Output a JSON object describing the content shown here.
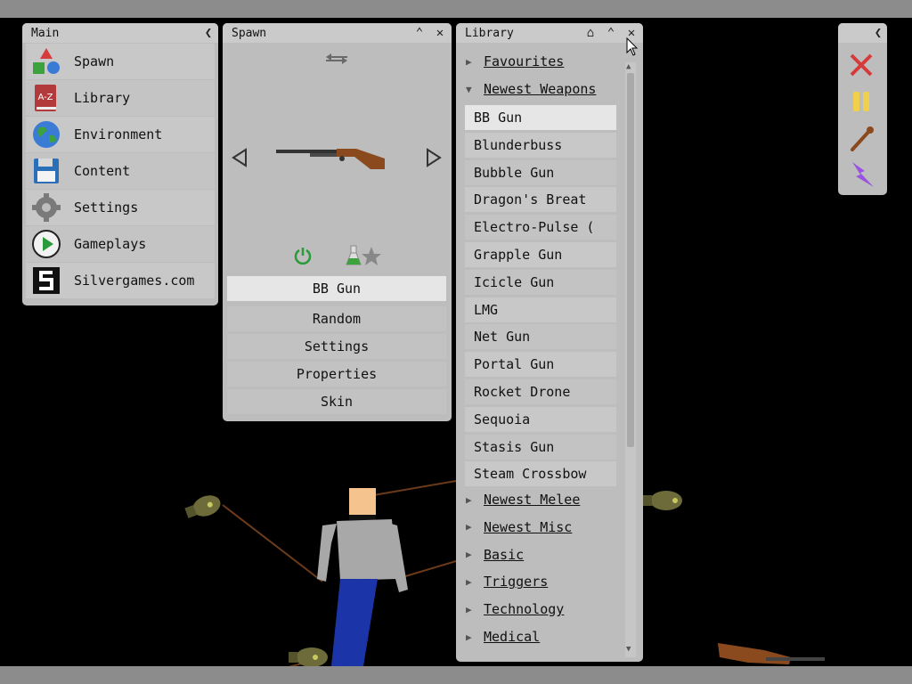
{
  "main_panel": {
    "title": "Main",
    "items": [
      {
        "label": "Spawn",
        "icon": "shapes-icon"
      },
      {
        "label": "Library",
        "icon": "book-icon"
      },
      {
        "label": "Environment",
        "icon": "globe-icon"
      },
      {
        "label": "Content",
        "icon": "floppy-disk-icon"
      },
      {
        "label": "Settings",
        "icon": "gear-icon"
      },
      {
        "label": "Gameplays",
        "icon": "play-icon"
      },
      {
        "label": "Silvergames.com",
        "icon": "silvergames-logo-icon"
      }
    ],
    "book_icon_text": "A-Z"
  },
  "spawn_panel": {
    "title": "Spawn",
    "selected_item": "BB Gun",
    "buttons": [
      "Random",
      "Settings",
      "Properties",
      "Skin"
    ]
  },
  "library_panel": {
    "title": "Library",
    "categories_top": [
      "Favourites",
      "Newest Weapons"
    ],
    "items": [
      "BB Gun",
      "Blunderbuss",
      "Bubble Gun",
      "Dragon's Breat",
      "Electro-Pulse (",
      "Grapple Gun",
      "Icicle Gun",
      "LMG",
      "Net Gun",
      "Portal Gun",
      "Rocket Drone",
      "Sequoia",
      "Stasis Gun",
      "Steam Crossbow"
    ],
    "selected_item": "BB Gun",
    "categories_bottom": [
      "Newest Melee",
      "Newest Misc",
      "Basic",
      "Triggers",
      "Technology",
      "Medical"
    ]
  },
  "tools_panel": {
    "tools": [
      "delete-icon",
      "pause-icon",
      "drag-icon",
      "lightning-icon"
    ]
  },
  "colors": {
    "panel_bg": "#bdbdbd",
    "selected_bg": "#e6e6e6",
    "delete_red": "#d63a3a",
    "pause_yellow": "#f0d04a",
    "lightning_purple": "#9a52e0",
    "rifle_brown": "#8b4a1e"
  }
}
